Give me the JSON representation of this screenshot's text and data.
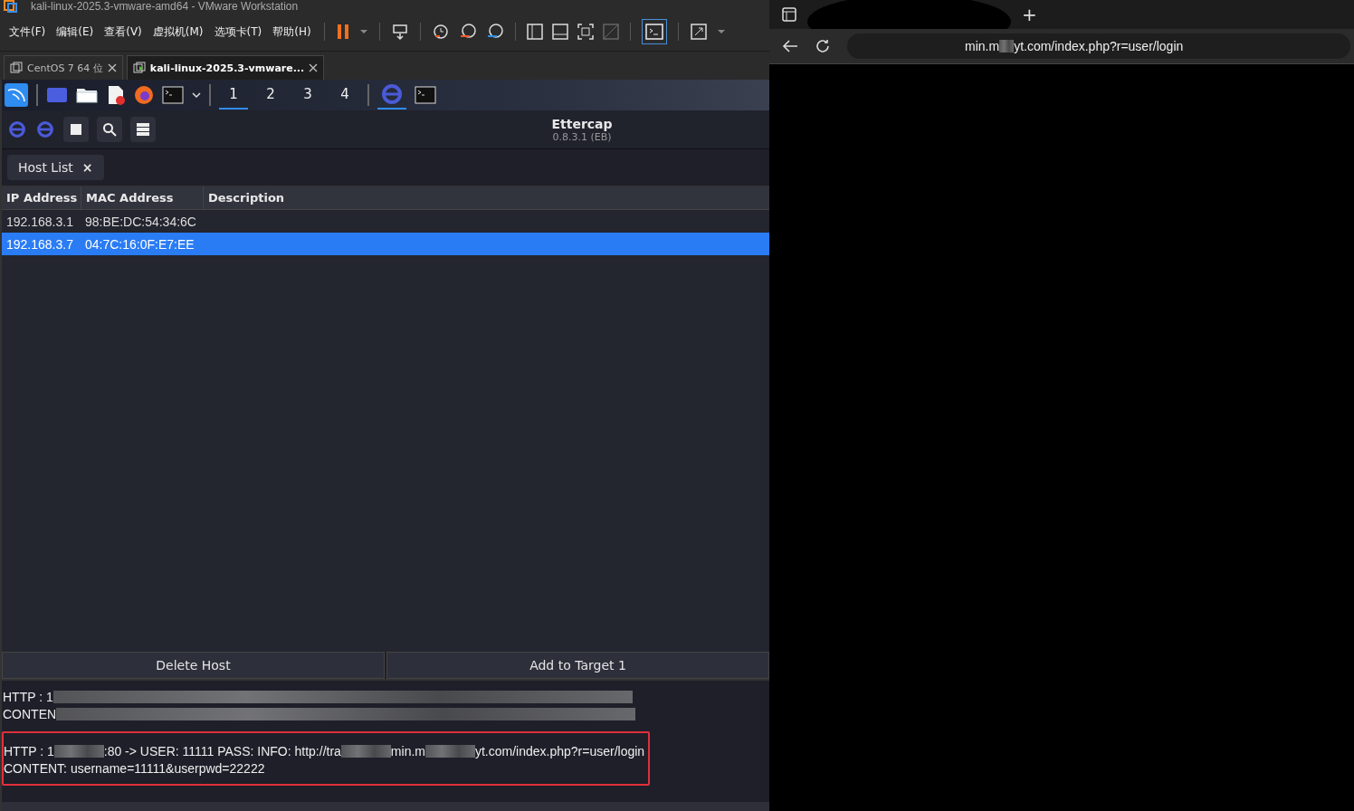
{
  "window": {
    "title": "kali-linux-2025.3-vmware-amd64 - VMware Workstation"
  },
  "menu": [
    "文件(F)",
    "编辑(E)",
    "查看(V)",
    "虚拟机(M)",
    "选项卡(T)",
    "帮助(H)"
  ],
  "vm_tabs": [
    {
      "label": "CentOS 7 64 位",
      "selected": false
    },
    {
      "label": "kali-linux-2025.3-vmware...",
      "selected": true
    }
  ],
  "panel": {
    "workspaces": [
      {
        "label": "1",
        "selected": true
      },
      {
        "label": "2",
        "selected": false
      },
      {
        "label": "3",
        "selected": false
      },
      {
        "label": "4",
        "selected": false
      }
    ]
  },
  "app": {
    "title": "Ettercap",
    "version": "0.8.3.1 (EB)"
  },
  "host_tab": {
    "label": "Host List",
    "close": "×"
  },
  "table": {
    "columns": [
      "IP Address",
      "MAC Address",
      "Description"
    ],
    "rows": [
      {
        "ip": "192.168.3.1",
        "mac": "98:BE:DC:54:34:6C",
        "selected": false
      },
      {
        "ip": "192.168.3.7",
        "mac": "04:7C:16:0F:E7:EE",
        "selected": true
      }
    ]
  },
  "buttons": [
    "Delete Host",
    "Add to Target 1"
  ],
  "log": [
    {
      "highlighted": false,
      "lines": [
        [
          {
            "kind": "text",
            "text": "HTTP : 1"
          },
          {
            "kind": "blur"
          }
        ],
        [
          {
            "kind": "text",
            "text": "CONTEN"
          },
          {
            "kind": "blur"
          }
        ]
      ]
    },
    {
      "highlighted": true,
      "lines": [
        [
          {
            "kind": "text",
            "text": "HTTP : 1"
          },
          {
            "kind": "blur"
          },
          {
            "kind": "text",
            "text": ":80 -> USER: 11111  PASS:   INFO: http://tra"
          },
          {
            "kind": "blur"
          },
          {
            "kind": "text",
            "text": "min.m"
          },
          {
            "kind": "blur"
          },
          {
            "kind": "text",
            "text": "yt.com/index.php?r=user/login"
          }
        ],
        [
          {
            "kind": "text",
            "text": "CONTENT: username=11111&userpwd=22222"
          }
        ]
      ]
    }
  ],
  "browser": {
    "new_tab": "+",
    "url": [
      {
        "kind": "text",
        "text": "min.m"
      },
      {
        "kind": "blur"
      },
      {
        "kind": "text",
        "text": "yt.com/index.php?r=user/login"
      }
    ]
  }
}
